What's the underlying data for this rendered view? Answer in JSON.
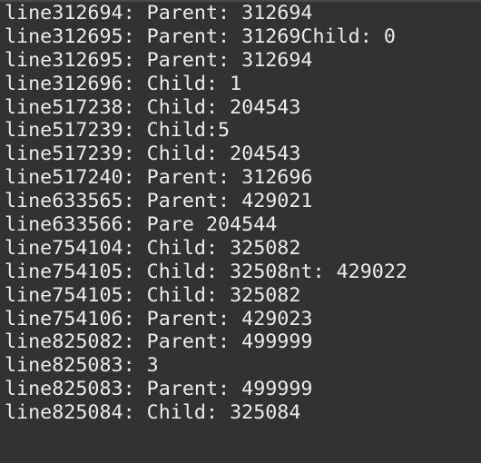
{
  "terminal": {
    "lines": [
      "line312694: Parent: 312694",
      "line312695: Parent: 31269Child: 0",
      "line312695: Parent: 312694",
      "line312696: Child: 1",
      "line517238: Child: 204543",
      "line517239: Child:5",
      "line517239: Child: 204543",
      "line517240: Parent: 312696",
      "line633565: Parent: 429021",
      "line633566: Pare 204544",
      "line754104: Child: 325082",
      "line754105: Child: 32508nt: 429022",
      "line754105: Child: 325082",
      "line754106: Parent: 429023",
      "line825082: Parent: 499999",
      "line825083: 3",
      "line825083: Parent: 499999",
      "line825084: Child: 325084"
    ]
  }
}
